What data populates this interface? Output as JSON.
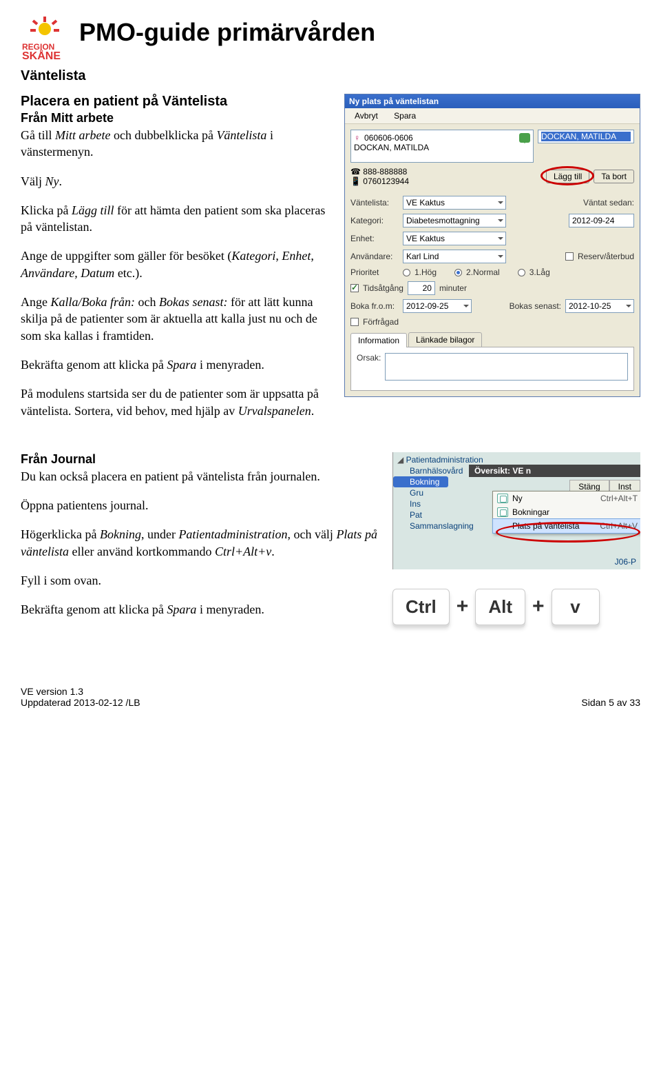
{
  "document": {
    "title": "PMO-guide primärvården",
    "section_label": "Väntelista"
  },
  "intro": {
    "heading": "Placera en patient på Väntelista",
    "sub1": "Från Mitt arbete",
    "p1a": "Gå till ",
    "p1b": "Mitt arbete",
    "p1c": " och dubbelklicka på ",
    "p1d": "Väntelista",
    "p1e": " i vänstermenyn.",
    "p2a": "Välj ",
    "p2b": "Ny",
    "p2c": ".",
    "p3a": "Klicka på ",
    "p3b": "Lägg till",
    "p3c": " för att hämta den patient som ska placeras på väntelistan.",
    "p4a": "Ange de uppgifter som gäller för besöket (",
    "p4b": "Kategori",
    "p4c": ", ",
    "p4d": "Enhet",
    "p4e": ", ",
    "p4f": "Användare, Datum",
    "p4g": " etc.).",
    "p5a": "Ange ",
    "p5b": "Kalla/Boka från:",
    "p5c": " och ",
    "p5d": "Bokas senast:",
    "p5e": " för att lätt kunna skilja på de patienter som är aktuella att kalla just nu och de som ska kallas i framtiden.",
    "p6a": "Bekräfta genom att klicka på ",
    "p6b": "Spara",
    "p6c": " i menyraden.",
    "p7a": "På modulens startsida ser du de patienter som är uppsatta på väntelista. Sortera, vid behov, med hjälp av ",
    "p7b": "Urvalspanelen",
    "p7c": "."
  },
  "dialog": {
    "title": "Ny plats på väntelistan",
    "menu": {
      "avbryt": "Avbryt",
      "spara": "Spara"
    },
    "patient_id": "060606-0606",
    "patient_name": "DOCKAN, MATILDA",
    "listed_name": "DOCKAN, MATILDA",
    "phone1": "888-888888",
    "phone2": "0760123944",
    "btn_add": "Lägg till",
    "btn_remove": "Ta bort",
    "labels": {
      "vantelista": "Väntelista:",
      "kategori": "Kategori:",
      "enhet": "Enhet:",
      "anvandare": "Användare:",
      "prioritet": "Prioritet",
      "vantat": "Väntat sedan:",
      "reserv": "Reserv/återbud",
      "tid": "Tidsåtgång",
      "minuter": "minuter",
      "boka_from": "Boka fr.o.m:",
      "bokas_senast": "Bokas senast:",
      "forfragad": "Förfrågad",
      "orsak": "Orsak:"
    },
    "values": {
      "vantelista": "VE Kaktus",
      "kategori": "Diabetesmottagning",
      "enhet": "VE Kaktus",
      "anvandare": "Karl Lind",
      "vantat": "2012-09-24",
      "tid": "20",
      "boka_from": "2012-09-25",
      "bokas_senast": "2012-10-25"
    },
    "priority": {
      "p1": "1.Hög",
      "p2": "2.Normal",
      "p3": "3.Låg"
    },
    "tabs": {
      "info": "Information",
      "linked": "Länkade bilagor"
    }
  },
  "journal_section": {
    "heading": "Från Journal",
    "p1": "Du kan också placera en patient på väntelista från journalen.",
    "p2": "Öppna patientens journal.",
    "p3a": "Högerklicka på ",
    "p3b": "Bokning",
    "p3c": ", under ",
    "p3d": "Patientadministration",
    "p3e": ", och välj ",
    "p3f": "Plats på väntelista",
    "p3g": " eller använd kortkommando ",
    "p3h": "Ctrl+Alt+v",
    "p3i": ".",
    "p4": "Fyll i som ovan.",
    "p5a": "Bekräfta genom att klicka på ",
    "p5b": "Spara",
    "p5c": " i menyraden."
  },
  "context_panel": {
    "sidebar": {
      "patientadmin": "Patientadministration",
      "barnhalsa": "Barnhälsovård",
      "bokning": "Bokning",
      "gru": "Gru",
      "ins": "Ins",
      "pat": "Pat",
      "samman": "Sammanslagning"
    },
    "overlay": {
      "title": "Översikt: VE n",
      "btn_stang": "Stäng",
      "btn_inst": "Inst",
      "code": "J06-P"
    },
    "menu": {
      "ny": "Ny",
      "ny_kb": "Ctrl+Alt+T",
      "bokningar": "Bokningar",
      "plats": "Plats på väntelista",
      "plats_kb": "Ctrl+Alt+V"
    }
  },
  "keys": {
    "ctrl": "Ctrl",
    "alt": "Alt",
    "v": "v",
    "plus": "+"
  },
  "footer": {
    "left1": "VE version 1.3",
    "left2": "Uppdaterad 2013-02-12 /LB",
    "right": "Sidan 5 av 33"
  }
}
